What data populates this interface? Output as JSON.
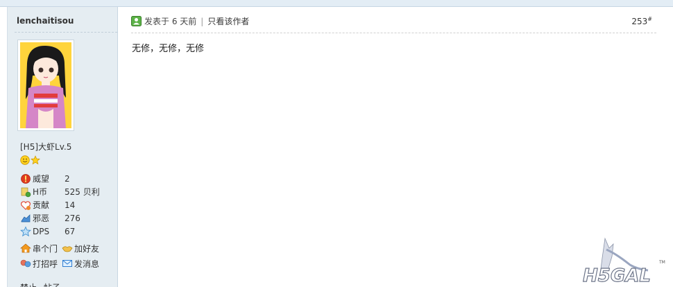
{
  "sidebar": {
    "username": "lenchaitisou",
    "rank": "[H5]大虾Lv.5",
    "stats": [
      {
        "label": "威望",
        "value": "2",
        "icon": "prestige-icon"
      },
      {
        "label": "H币",
        "value": "525 贝利",
        "icon": "coin-icon"
      },
      {
        "label": "贡献",
        "value": "14",
        "icon": "heart-icon"
      },
      {
        "label": "邪恶",
        "value": "276",
        "icon": "evil-icon"
      },
      {
        "label": "DPS",
        "value": "67",
        "icon": "star-icon"
      }
    ],
    "actions": {
      "visit": "串个门",
      "add_friend": "加好友",
      "greet": "打招呼",
      "message": "发消息"
    },
    "ban": "禁止",
    "posts": "帖子"
  },
  "post": {
    "posted": "发表于 6 天前",
    "separator": "|",
    "only_author": "只看该作者",
    "floor": "253",
    "floor_mark": "#",
    "content": "无修，无修，无修"
  },
  "watermark": {
    "text": "H5GAL",
    "tm": "TM"
  },
  "colors": {
    "sidebar_bg": "#e5edf2",
    "accent_blue": "#2a6bbd"
  }
}
